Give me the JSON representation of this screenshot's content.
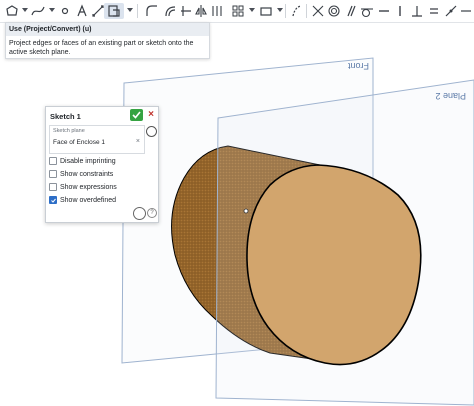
{
  "toolbar": {
    "icons": [
      "circle-tool",
      "sketch-dropdown",
      "spline-tool",
      "spline-dropdown",
      "point-tool",
      "text-tool",
      "dimension-tool",
      "use-tool",
      "use-dropdown",
      "fillet-tool",
      "offset-tool",
      "trim-tool",
      "mirror-tool",
      "pattern-tool",
      "pattern-dropdown",
      "transform-tool",
      "transform-dropdown",
      "construction-tool",
      "coincident-tool",
      "concentric-tool",
      "parallel-tool",
      "tangent-tool",
      "horizontal-tool",
      "vertical-tool",
      "perpendicular-tool",
      "equal-tool",
      "more-tool"
    ]
  },
  "tooltip": {
    "title": "Use (Project/Convert) (u)",
    "body": "Project edges or faces of an existing part or sketch onto the active sketch plane."
  },
  "panel": {
    "title": "Sketch 1",
    "plane_label": "Sketch plane",
    "plane_value": "Face of Enclose 1",
    "clear_glyph": "×",
    "help_glyph": "?",
    "checkboxes": [
      {
        "label": "Disable imprinting",
        "checked": false
      },
      {
        "label": "Show constraints",
        "checked": false
      },
      {
        "label": "Show expressions",
        "checked": false
      },
      {
        "label": "Show overdefined",
        "checked": true
      }
    ]
  },
  "viewport": {
    "plane_front": "Front",
    "plane_2": "Plane 2",
    "colors": {
      "plane_line": "#9fb3cf",
      "cylinder_side": "#9a6a30",
      "cylinder_face": "#d2a56d",
      "edge": "#000000"
    }
  }
}
